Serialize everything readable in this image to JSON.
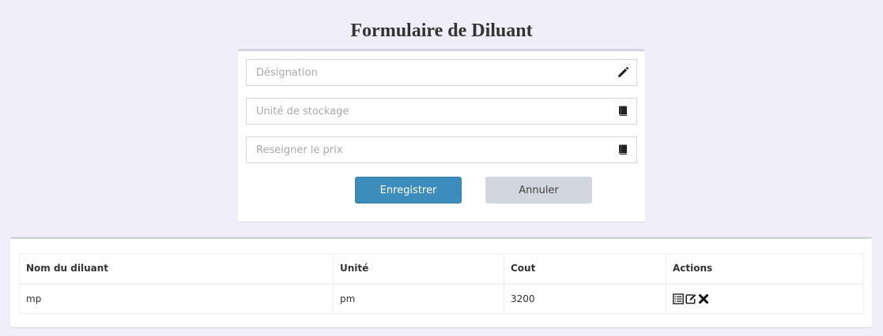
{
  "page": {
    "title": "Formulaire de Diluant"
  },
  "form": {
    "fields": [
      {
        "placeholder": "Désignation",
        "value": "",
        "icon": "pencil-icon"
      },
      {
        "placeholder": "Unité de stockage",
        "value": "",
        "icon": "book-icon"
      },
      {
        "placeholder": "Reseigner le prix",
        "value": "",
        "icon": "book-icon"
      }
    ],
    "save_label": "Enregistrer",
    "cancel_label": "Annuler"
  },
  "colors": {
    "background": "#f0eff9",
    "primary": "#3c8dbc",
    "secondary": "#d2d6de"
  },
  "table": {
    "headers": [
      "Nom du diluant",
      "Unité",
      "Cout",
      "Actions"
    ],
    "rows": [
      {
        "nom": "mp",
        "unite": "pm",
        "cout": "3200",
        "actions": [
          "list-icon",
          "edit-icon",
          "delete-icon"
        ]
      }
    ]
  }
}
